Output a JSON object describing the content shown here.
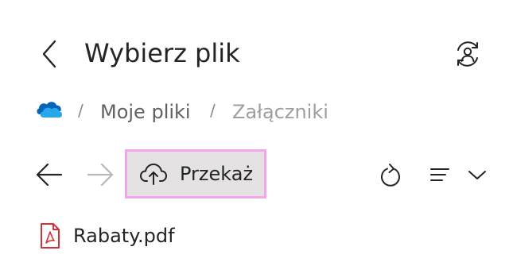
{
  "header": {
    "title": "Wybierz plik",
    "back_icon": "chevron-left-icon",
    "account_icon": "account-switch-icon"
  },
  "breadcrumb": {
    "root_icon": "onedrive-cloud-icon",
    "separator": "/",
    "items": [
      {
        "label": "Moje pliki"
      },
      {
        "label": "Załączniki"
      }
    ]
  },
  "toolbar": {
    "back_icon": "arrow-left-icon",
    "forward_icon": "arrow-right-icon",
    "upload_label": "Przekaż",
    "upload_icon": "cloud-upload-icon",
    "refresh_icon": "refresh-icon",
    "view_icon": "list-view-icon",
    "view_dropdown_icon": "chevron-down-icon"
  },
  "files": [
    {
      "name": "Rabaty.pdf",
      "icon": "pdf-file-icon"
    }
  ],
  "colors": {
    "text": "#242424",
    "muted_text": "#616161",
    "disabled_text": "#9e9e9e",
    "upload_button_bg": "#e4e2e2",
    "focus_outline": "#f4a6ec",
    "pdf_red": "#d13438",
    "onedrive_dark": "#0364b8",
    "onedrive_light": "#28a8ea"
  }
}
